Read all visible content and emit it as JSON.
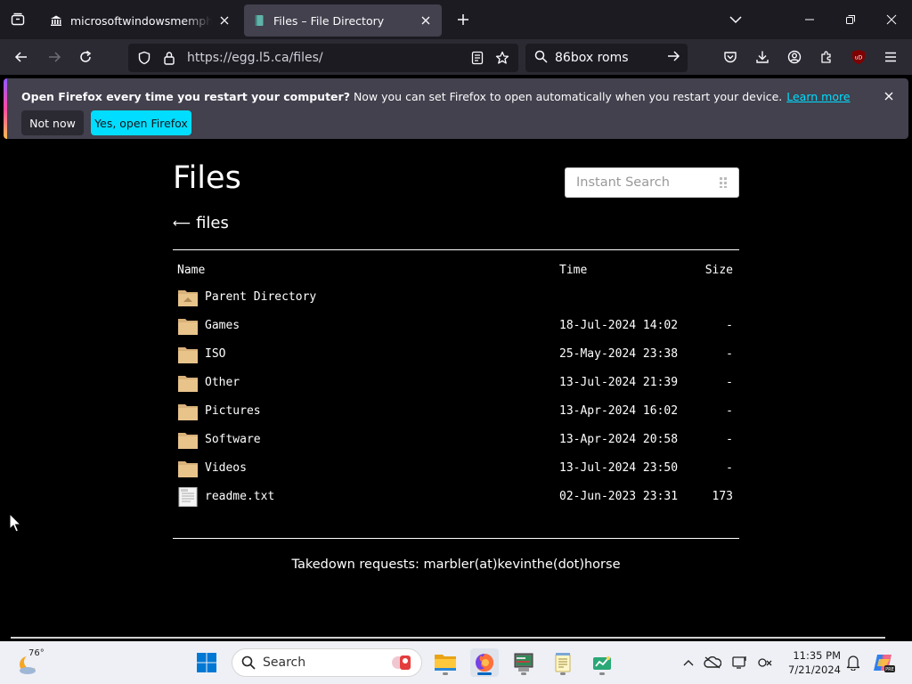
{
  "browser": {
    "tabs": [
      {
        "title": "microsoftwindowsmemphisbu",
        "active": false
      },
      {
        "title": "Files – File Directory",
        "active": true
      }
    ],
    "url": "https://egg.l5.ca/files/",
    "search_value": "86box roms",
    "extension_badge": "uD"
  },
  "notification": {
    "bold_text": "Open Firefox every time you restart your computer?",
    "text": "Now you can set Firefox to open automatically when you restart your device.",
    "link": "Learn more",
    "button_dismiss": "Not now",
    "button_accept": "Yes, open Firefox",
    "accent_color": "#00ddff"
  },
  "page": {
    "title": "Files",
    "search_placeholder": "Instant Search",
    "breadcrumb_arrow": "⟵",
    "breadcrumb": "files",
    "columns": {
      "name": "Name",
      "time": "Time",
      "size": "Size"
    },
    "rows": [
      {
        "name": "Parent Directory",
        "time": "",
        "size": "",
        "icon": "folder-up-icon"
      },
      {
        "name": "Games",
        "time": "18-Jul-2024 14:02",
        "size": "-",
        "icon": "folder-icon"
      },
      {
        "name": "ISO",
        "time": "25-May-2024 23:38",
        "size": "-",
        "icon": "folder-icon"
      },
      {
        "name": "Other",
        "time": "13-Jul-2024 21:39",
        "size": "-",
        "icon": "folder-icon"
      },
      {
        "name": "Pictures",
        "time": "13-Apr-2024 16:02",
        "size": "-",
        "icon": "folder-icon"
      },
      {
        "name": "Software",
        "time": "13-Apr-2024 20:58",
        "size": "-",
        "icon": "folder-icon"
      },
      {
        "name": "Videos",
        "time": "13-Jul-2024 23:50",
        "size": "-",
        "icon": "folder-icon"
      },
      {
        "name": "readme.txt",
        "time": "02-Jun-2023 23:31",
        "size": "173",
        "icon": "text-file-icon"
      }
    ],
    "footer": "Takedown requests: marbler(at)kevinthe(dot)horse"
  },
  "taskbar": {
    "weather_temp": "76°",
    "search_label": "Search",
    "time": "11:35 PM",
    "date": "7/21/2024"
  }
}
